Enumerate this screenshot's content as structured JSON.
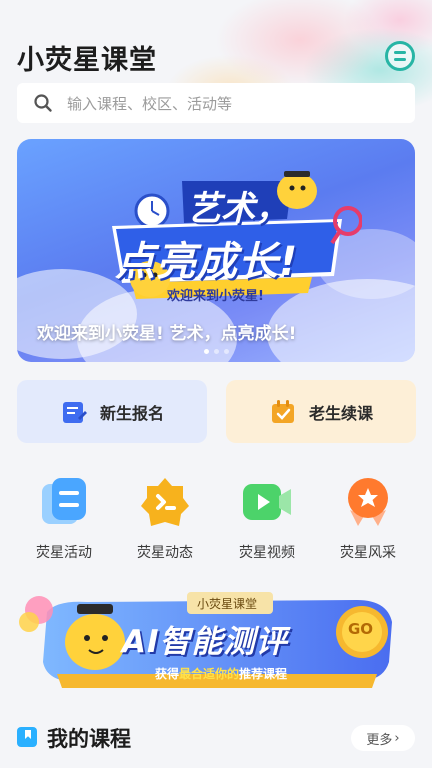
{
  "header": {
    "title": "小荧星课堂",
    "menu_icon": "menu-lines-icon"
  },
  "search": {
    "placeholder": "输入课程、校区、活动等",
    "icon": "search-icon"
  },
  "banner": {
    "headline_1": "艺术，",
    "headline_2": "点亮成长!",
    "ribbon": "欢迎来到小荧星!",
    "caption": "欢迎来到小荧星! 艺术，点亮成长!",
    "slides_total": 3,
    "active_slide": 1
  },
  "actions": [
    {
      "label": "新生报名",
      "icon": "form-edit-icon",
      "color": "#3f6cf0"
    },
    {
      "label": "老生续课",
      "icon": "calendar-check-icon",
      "color": "#f3a525"
    }
  ],
  "grid": [
    {
      "label": "荧星活动",
      "icon": "activity-icon",
      "color": "#4aa6ff"
    },
    {
      "label": "荧星动态",
      "icon": "star-news-icon",
      "color": "#f7b21d"
    },
    {
      "label": "荧星视频",
      "icon": "video-icon",
      "color": "#4cd36a"
    },
    {
      "label": "荧星风采",
      "icon": "showcase-icon",
      "color": "#ff7a2e"
    }
  ],
  "ai_banner": {
    "tag": "小荧星课堂",
    "title": "AI智能测评",
    "subtitle_prefix": "获得",
    "subtitle_highlight": "最合适你的",
    "subtitle_suffix": "推荐课程",
    "go": "GO"
  },
  "my_courses": {
    "title": "我的课程",
    "more": "更多"
  },
  "colors": {
    "accent_teal": "#27b5a5",
    "banner_blue": "#5b7cf0"
  }
}
